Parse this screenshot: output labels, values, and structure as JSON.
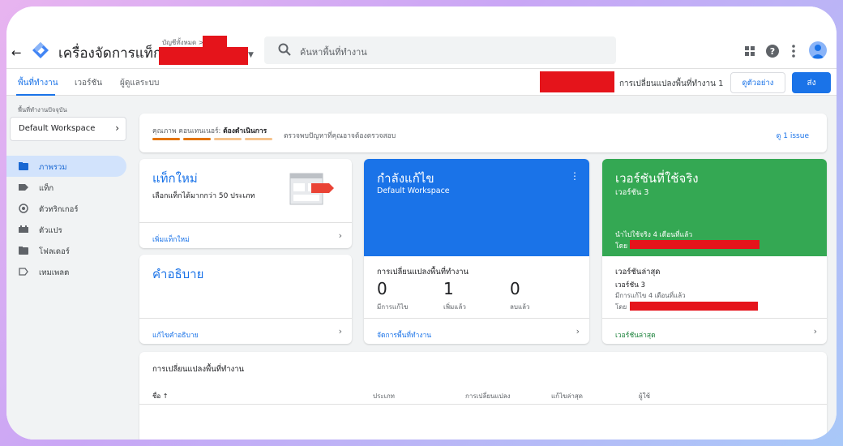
{
  "app": {
    "title": "เครื่องจัดการแท็ก",
    "account_label": "บัญชีทั้งหมด >",
    "search_placeholder": "ค้นหาพื้นที่ทำงาน",
    "colors": {
      "primary": "#1a73e8",
      "redaction": "#e5141b",
      "live_green": "#34a853"
    }
  },
  "tabs": [
    {
      "label": "พื้นที่ทำงาน"
    },
    {
      "label": "เวอร์ชัน"
    },
    {
      "label": "ผู้ดูแลระบบ"
    }
  ],
  "header_actions": {
    "changes_text": "การเปลี่ยนแปลงพื้นที่ทำงาน 1",
    "preview_label": "ดูตัวอย่าง",
    "submit_label": "ส่ง"
  },
  "sidebar": {
    "workspace_label": "พื้นที่ทำงานปัจจุบัน",
    "workspace_name": "Default Workspace",
    "items": [
      {
        "label": "ภาพรวม",
        "icon": "folder-icon"
      },
      {
        "label": "แท็ก",
        "icon": "tag-icon"
      },
      {
        "label": "ตัวทริกเกอร์",
        "icon": "trigger-icon"
      },
      {
        "label": "ตัวแปร",
        "icon": "variable-icon"
      },
      {
        "label": "โฟลเดอร์",
        "icon": "folder-icon"
      },
      {
        "label": "เทมเพลต",
        "icon": "template-icon"
      }
    ]
  },
  "quality": {
    "prefix": "คุณภาพ คอนเทนเนอร์:",
    "status": "ต้องดำเนินการ",
    "message": "ตรวจพบปัญหาที่คุณอาจต้องตรวจสอบ",
    "link": "ดู 1 issue"
  },
  "new_tag": {
    "title": "แท็กใหม่",
    "subtitle": "เลือกแท็กได้มากกว่า 50 ประเภท",
    "link": "เพิ่มแท็กใหม่"
  },
  "description": {
    "title": "คำอธิบาย",
    "link": "แก้ไขคำอธิบาย"
  },
  "editing": {
    "title": "กำลังแก้ไข",
    "workspace": "Default Workspace",
    "changes_title": "การเปลี่ยนแปลงพื้นที่ทำงาน",
    "stats": [
      {
        "value": "0",
        "label": "มีการแก้ไข"
      },
      {
        "value": "1",
        "label": "เพิ่มแล้ว"
      },
      {
        "value": "0",
        "label": "ลบแล้ว"
      }
    ],
    "link": "จัดการพื้นที่ทำงาน"
  },
  "live": {
    "title": "เวอร์ชันที่ใช้จริง",
    "version": "เวอร์ชัน 3",
    "published": "นำไปใช้จริง 4 เดือนที่แล้ว",
    "by": "โดย",
    "latest_title": "เวอร์ชันล่าสุด",
    "latest_version": "เวอร์ชัน 3",
    "latest_edited": "มีการแก้ไข 4 เดือนที่แล้ว",
    "latest_by": "โดย",
    "link": "เวอร์ชันล่าสุด"
  },
  "changes_table": {
    "title": "การเปลี่ยนแปลงพื้นที่ทำงาน",
    "columns": [
      "ชื่อ ↑",
      "ประเภท",
      "การเปลี่ยนแปลง",
      "แก้ไขล่าสุด",
      "ผู้ใช้"
    ]
  }
}
